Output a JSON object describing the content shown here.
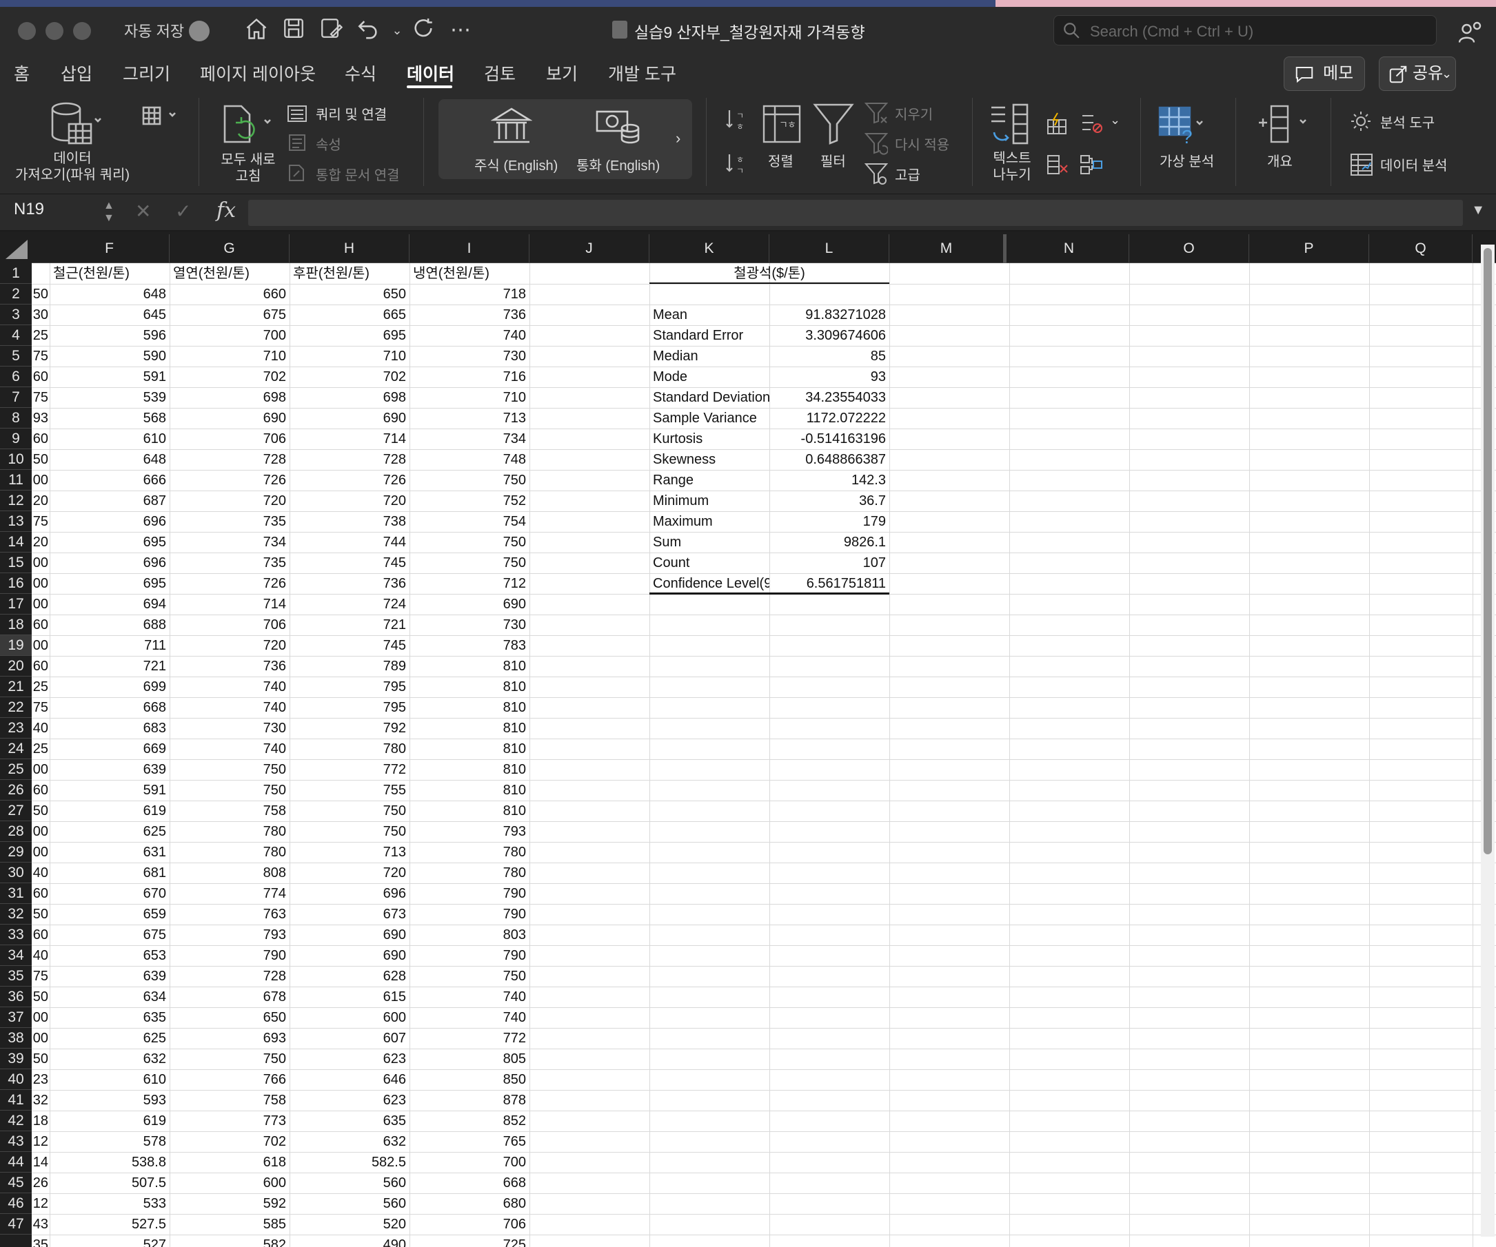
{
  "window": {
    "autosave_label": "자동 저장",
    "title": "실습9 산자부_철강원자재 가격동향",
    "search_placeholder": "Search (Cmd + Ctrl + U)"
  },
  "tabs": [
    "홈",
    "삽입",
    "그리기",
    "페이지 레이아웃",
    "수식",
    "데이터",
    "검토",
    "보기",
    "개발 도구"
  ],
  "active_tab": "데이터",
  "header_buttons": {
    "comments": "메모",
    "share": "공유"
  },
  "ribbon": {
    "get_data": [
      "데이터",
      "가져오기(파워 쿼리)"
    ],
    "refresh_all": [
      "모두 새로",
      "고침"
    ],
    "queries": "쿼리 및 연결",
    "properties": "속성",
    "edit_links": "통합 문서 연결",
    "stocks": "주식 (English)",
    "currencies": "통화 (English)",
    "sort": "정렬",
    "filter": "필터",
    "clear": "지우기",
    "reapply": "다시 적용",
    "advanced": "고급",
    "text_to_columns": [
      "텍스트",
      "나누기"
    ],
    "what_if": "가상 분석",
    "outline": "개요",
    "analysis_tools": "분석 도구",
    "data_analysis": "데이터 분석"
  },
  "formula_bar": {
    "name_box": "N19",
    "fx": "fx",
    "formula": ""
  },
  "columns": [
    "F",
    "G",
    "H",
    "I",
    "J",
    "K",
    "L",
    "M",
    "N",
    "O",
    "P",
    "Q"
  ],
  "headers_row1": {
    "F": "철근(천원/톤)",
    "G": "열연(천원/톤)",
    "H": "후판(천원/톤)",
    "I": "냉연(천원/톤)",
    "KL": "철광석($/톤)"
  },
  "col_e_partial": [
    "50",
    "30",
    "25",
    "75",
    "60",
    "75",
    "93",
    "60",
    "50",
    "00",
    "20",
    "75",
    "20",
    "00",
    "00",
    "00",
    "60",
    "00",
    "60",
    "25",
    "75",
    "40",
    "25",
    "00",
    "60",
    "50",
    "00",
    "00",
    "40",
    "60",
    "50",
    "60",
    "40",
    "75",
    "50",
    "00",
    "00",
    "50",
    "23",
    "32",
    "18",
    "12",
    "14",
    "26",
    "12",
    "43",
    "35"
  ],
  "data_rows": [
    [
      "648",
      "660",
      "650",
      "718"
    ],
    [
      "645",
      "675",
      "665",
      "736"
    ],
    [
      "596",
      "700",
      "695",
      "740"
    ],
    [
      "590",
      "710",
      "710",
      "730"
    ],
    [
      "591",
      "702",
      "702",
      "716"
    ],
    [
      "539",
      "698",
      "698",
      "710"
    ],
    [
      "568",
      "690",
      "690",
      "713"
    ],
    [
      "610",
      "706",
      "714",
      "734"
    ],
    [
      "648",
      "728",
      "728",
      "748"
    ],
    [
      "666",
      "726",
      "726",
      "750"
    ],
    [
      "687",
      "720",
      "720",
      "752"
    ],
    [
      "696",
      "735",
      "738",
      "754"
    ],
    [
      "695",
      "734",
      "744",
      "750"
    ],
    [
      "696",
      "735",
      "745",
      "750"
    ],
    [
      "695",
      "726",
      "736",
      "712"
    ],
    [
      "694",
      "714",
      "724",
      "690"
    ],
    [
      "688",
      "706",
      "721",
      "730"
    ],
    [
      "711",
      "720",
      "745",
      "783"
    ],
    [
      "721",
      "736",
      "789",
      "810"
    ],
    [
      "699",
      "740",
      "795",
      "810"
    ],
    [
      "668",
      "740",
      "795",
      "810"
    ],
    [
      "683",
      "730",
      "792",
      "810"
    ],
    [
      "669",
      "740",
      "780",
      "810"
    ],
    [
      "639",
      "750",
      "772",
      "810"
    ],
    [
      "591",
      "750",
      "755",
      "810"
    ],
    [
      "619",
      "758",
      "750",
      "810"
    ],
    [
      "625",
      "780",
      "750",
      "793"
    ],
    [
      "631",
      "780",
      "713",
      "780"
    ],
    [
      "681",
      "808",
      "720",
      "780"
    ],
    [
      "670",
      "774",
      "696",
      "790"
    ],
    [
      "659",
      "763",
      "673",
      "790"
    ],
    [
      "675",
      "793",
      "690",
      "803"
    ],
    [
      "653",
      "790",
      "690",
      "790"
    ],
    [
      "639",
      "728",
      "628",
      "750"
    ],
    [
      "634",
      "678",
      "615",
      "740"
    ],
    [
      "635",
      "650",
      "600",
      "740"
    ],
    [
      "625",
      "693",
      "607",
      "772"
    ],
    [
      "632",
      "750",
      "623",
      "805"
    ],
    [
      "610",
      "766",
      "646",
      "850"
    ],
    [
      "593",
      "758",
      "623",
      "878"
    ],
    [
      "619",
      "773",
      "635",
      "852"
    ],
    [
      "578",
      "702",
      "632",
      "765"
    ],
    [
      "538.8",
      "618",
      "582.5",
      "700"
    ],
    [
      "507.5",
      "600",
      "560",
      "668"
    ],
    [
      "533",
      "592",
      "560",
      "680"
    ],
    [
      "527.5",
      "585",
      "520",
      "706"
    ],
    [
      "527",
      "582",
      "490",
      "725"
    ]
  ],
  "stats": [
    [
      "Mean",
      "91.83271028"
    ],
    [
      "Standard Error",
      "3.309674606"
    ],
    [
      "Median",
      "85"
    ],
    [
      "Mode",
      "93"
    ],
    [
      "Standard Deviation",
      "34.23554033"
    ],
    [
      "Sample Variance",
      "1172.072222"
    ],
    [
      "Kurtosis",
      "-0.514163196"
    ],
    [
      "Skewness",
      "0.648866387"
    ],
    [
      "Range",
      "142.3"
    ],
    [
      "Minimum",
      "36.7"
    ],
    [
      "Maximum",
      "179"
    ],
    [
      "Sum",
      "9826.1"
    ],
    [
      "Count",
      "107"
    ],
    [
      "Confidence Level(95.0%)",
      "6.561751811"
    ]
  ],
  "row_numbers": [
    "1",
    "2",
    "3",
    "4",
    "5",
    "6",
    "7",
    "8",
    "9",
    "10",
    "11",
    "12",
    "13",
    "14",
    "15",
    "16",
    "17",
    "18",
    "19",
    "20",
    "21",
    "22",
    "23",
    "24",
    "25",
    "26",
    "27",
    "28",
    "29",
    "30",
    "31",
    "32",
    "33",
    "34",
    "35",
    "36",
    "37",
    "38",
    "39",
    "40",
    "41",
    "42",
    "43",
    "44",
    "45",
    "46",
    "47"
  ],
  "selected_row": "19"
}
